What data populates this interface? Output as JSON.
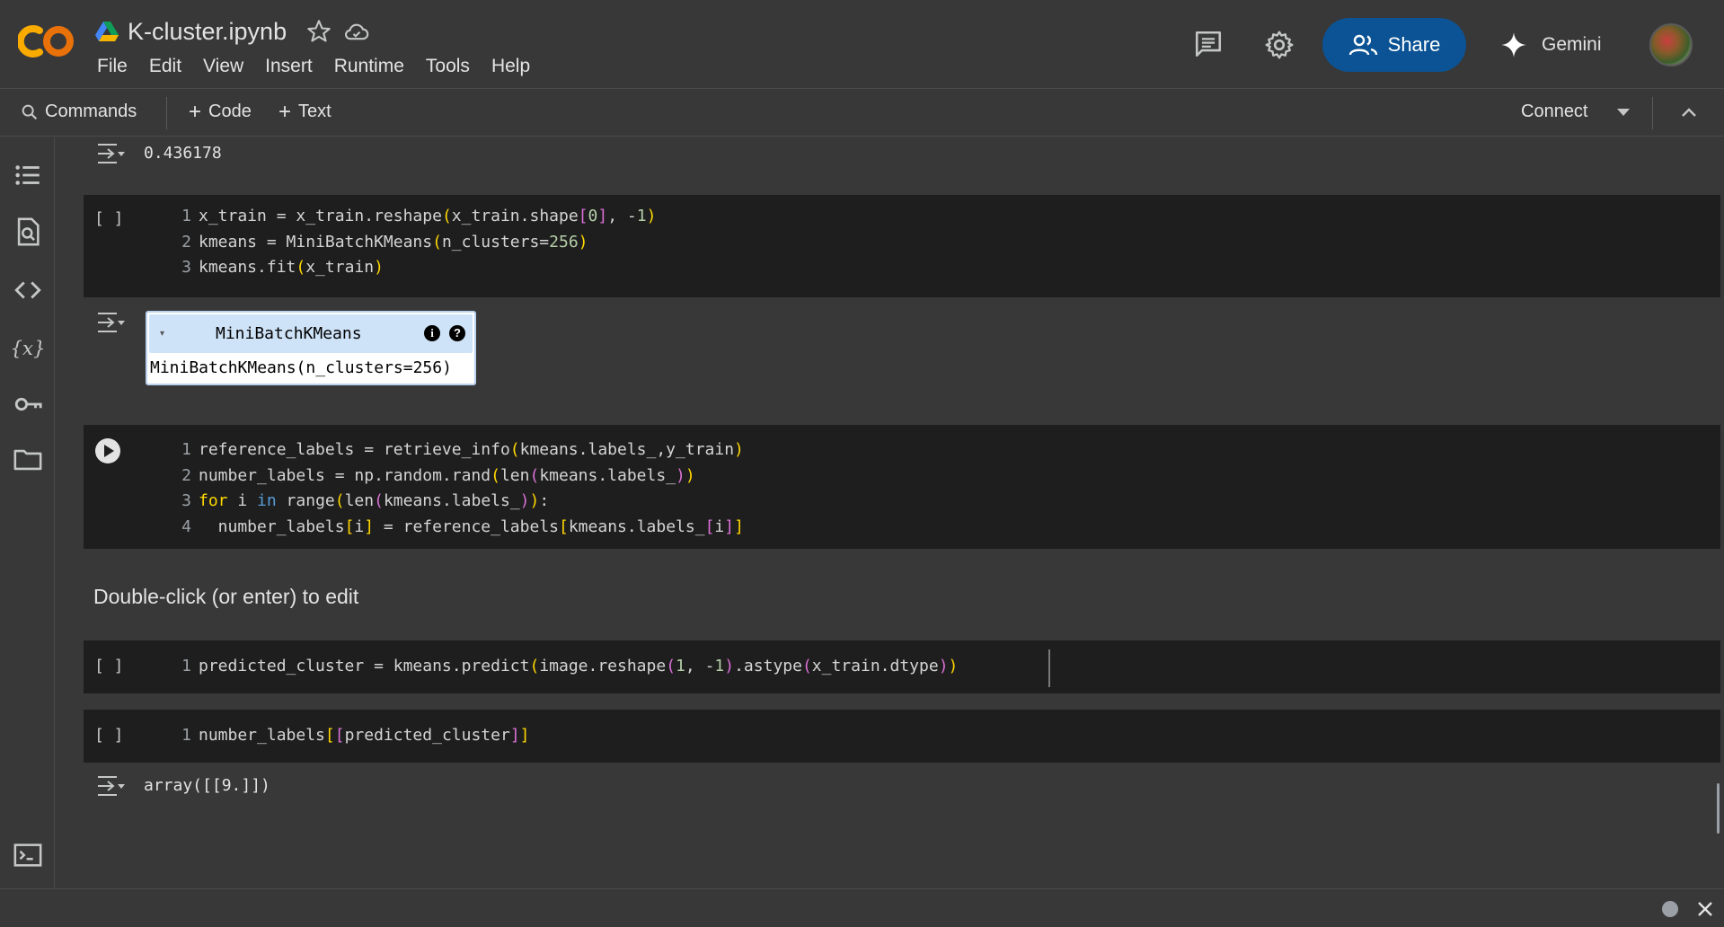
{
  "app": {
    "doc_title": "K-cluster.ipynb",
    "menu": [
      "File",
      "Edit",
      "View",
      "Insert",
      "Runtime",
      "Tools",
      "Help"
    ],
    "share_label": "Share",
    "gemini_label": "Gemini",
    "colors": {
      "accent": "#0b5394",
      "background": "#383838",
      "cell_bg": "#1e1e1e"
    }
  },
  "toolbar": {
    "commands_label": "Commands",
    "code_label": "Code",
    "text_label": "Text",
    "connect_label": "Connect",
    "plus": "+"
  },
  "cells": {
    "out0": {
      "text": "0.436178"
    },
    "c1": {
      "bracket": "[ ]"
    },
    "model": {
      "name": "MiniBatchKMeans",
      "repr": "MiniBatchKMeans(n_clusters=256)",
      "arrow": "▾",
      "info": "i",
      "help": "?"
    },
    "markdown": {
      "text": "Double-click (or enter) to edit"
    },
    "c3": {
      "bracket": "[ ]"
    },
    "c4": {
      "bracket": "[ ]"
    },
    "out4": {
      "text": "array([[9.]])"
    }
  },
  "icons": [
    "colab-logo",
    "drive-icon",
    "star-icon",
    "cloud-icon",
    "comment-icon",
    "gear-icon",
    "people-icon",
    "sparkle-icon",
    "search-icon",
    "chevron-down-icon",
    "chevron-up-icon",
    "table-of-contents-icon",
    "find-icon",
    "code-snippets-icon",
    "variables-icon",
    "key-icon",
    "folder-icon",
    "terminal-icon",
    "output-icon",
    "play-icon",
    "close-icon"
  ]
}
